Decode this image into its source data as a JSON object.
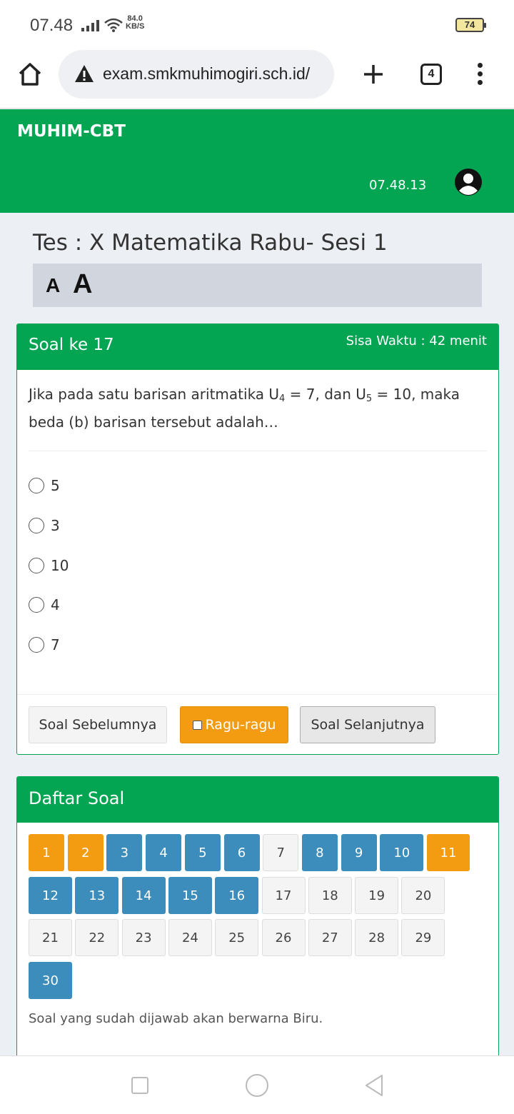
{
  "statusbar": {
    "time": "07.48",
    "speed_value": "84.0",
    "speed_unit": "KB/S",
    "battery": "74"
  },
  "browser": {
    "url": "exam.smkmuhimogiri.sch.id/",
    "tab_count": "4"
  },
  "header": {
    "brand": "MUHIM-CBT",
    "clock": "07.48.13"
  },
  "test": {
    "title": "Tes : X Matematika Rabu- Sesi 1",
    "font_small": "A",
    "font_large": "A"
  },
  "question": {
    "number_label": "Soal ke 17",
    "time_left": "Sisa Waktu : 42 menit",
    "text_part1": "Jika pada satu barisan aritmatika U",
    "sub1": "4",
    "text_part2": " = 7, dan U",
    "sub2": "5",
    "text_part3": " = 10, maka beda (b) barisan tersebut adalah…",
    "options": [
      "5",
      "3",
      "10",
      "4",
      "7"
    ],
    "prev_label": "Soal Sebelumnya",
    "ragu_label": "Ragu-ragu",
    "next_label": "Soal Selanjutnya"
  },
  "daftar": {
    "title": "Daftar Soal",
    "items": [
      {
        "n": "1",
        "s": "orange"
      },
      {
        "n": "2",
        "s": "orange"
      },
      {
        "n": "3",
        "s": "blue"
      },
      {
        "n": "4",
        "s": "blue"
      },
      {
        "n": "5",
        "s": "blue"
      },
      {
        "n": "6",
        "s": "blue"
      },
      {
        "n": "7",
        "s": "grey"
      },
      {
        "n": "8",
        "s": "blue"
      },
      {
        "n": "9",
        "s": "blue"
      },
      {
        "n": "10",
        "s": "blue"
      },
      {
        "n": "11",
        "s": "orange"
      },
      {
        "n": "12",
        "s": "blue"
      },
      {
        "n": "13",
        "s": "blue"
      },
      {
        "n": "14",
        "s": "blue"
      },
      {
        "n": "15",
        "s": "blue"
      },
      {
        "n": "16",
        "s": "blue"
      },
      {
        "n": "17",
        "s": "grey"
      },
      {
        "n": "18",
        "s": "grey"
      },
      {
        "n": "19",
        "s": "grey"
      },
      {
        "n": "20",
        "s": "grey"
      },
      {
        "n": "21",
        "s": "grey"
      },
      {
        "n": "22",
        "s": "grey"
      },
      {
        "n": "23",
        "s": "grey"
      },
      {
        "n": "24",
        "s": "grey"
      },
      {
        "n": "25",
        "s": "grey"
      },
      {
        "n": "26",
        "s": "grey"
      },
      {
        "n": "27",
        "s": "grey"
      },
      {
        "n": "28",
        "s": "grey"
      },
      {
        "n": "29",
        "s": "grey"
      },
      {
        "n": "30",
        "s": "blue"
      }
    ],
    "note": "Soal yang sudah dijawab akan berwarna Biru."
  },
  "colors": {
    "brand_green": "#03a552",
    "answered_blue": "#3c8dbc",
    "doubt_orange": "#f39c12"
  }
}
